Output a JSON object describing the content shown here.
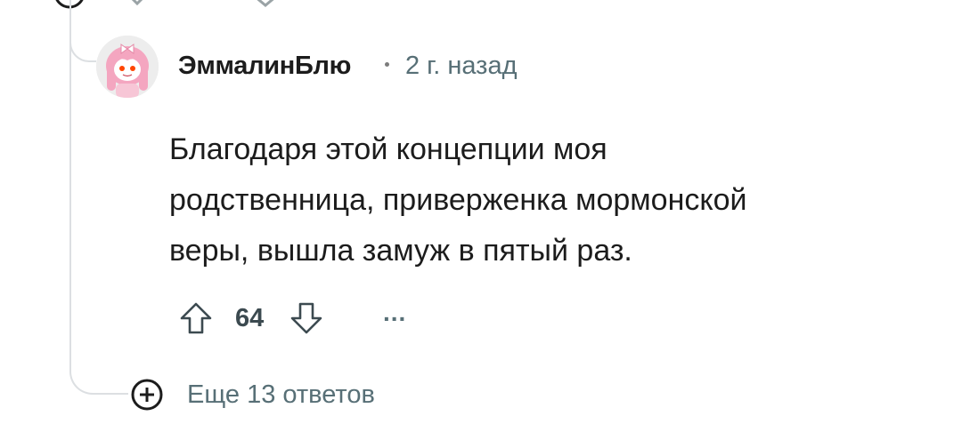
{
  "comment": {
    "username": "ЭммалинБлю",
    "separator": "•",
    "timestamp": "2 г. назад",
    "avatar_icon": "reddit-avatar-pink-hair",
    "body_lines": [
      "Благодаря этой концепции моя",
      "родственница, приверженка мормонской",
      "веры, вышла замуж в пятый раз."
    ],
    "score": "64",
    "more_label": "..."
  },
  "replies": {
    "more_label": "Еще 13 ответов",
    "icon": "plus-circle-icon"
  },
  "colors": {
    "thread_line": "#dcdfe2",
    "meta_text": "#576f76",
    "body_text": "#1c1c1c",
    "avatar_hair": "#f4a6c0"
  }
}
